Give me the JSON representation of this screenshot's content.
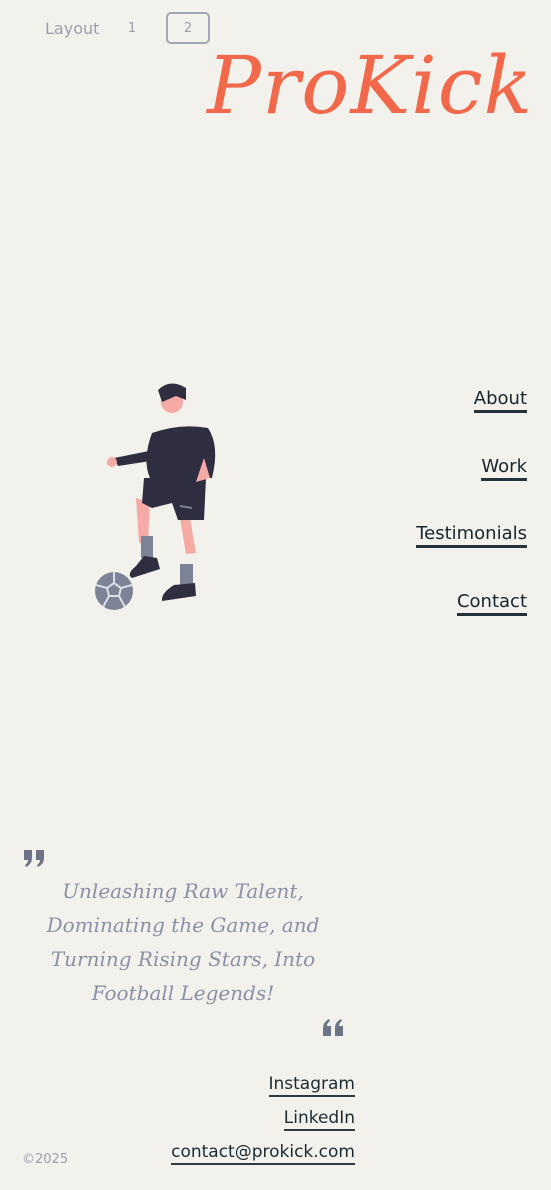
{
  "layout_switch": {
    "label": "Layout",
    "options": [
      "1",
      "2"
    ],
    "selected": "2"
  },
  "brand": {
    "logo_text": "ProKick",
    "accent_color": "#f2684a"
  },
  "hero": {
    "illustration": "soccer-player-illustration"
  },
  "nav": {
    "items": [
      {
        "label": "About"
      },
      {
        "label": "Work"
      },
      {
        "label": "Testimonials"
      },
      {
        "label": "Contact"
      }
    ]
  },
  "quote": {
    "text": "Unleashing Raw Talent, Dominating the Game, and Turning Rising Stars, Into Football Legends!",
    "open_icon": "quote-open-icon",
    "close_icon": "quote-close-icon"
  },
  "footer": {
    "links": [
      {
        "label": "Instagram"
      },
      {
        "label": "LinkedIn"
      },
      {
        "label": "contact@prokick.com"
      }
    ],
    "copyright": "©2025"
  }
}
